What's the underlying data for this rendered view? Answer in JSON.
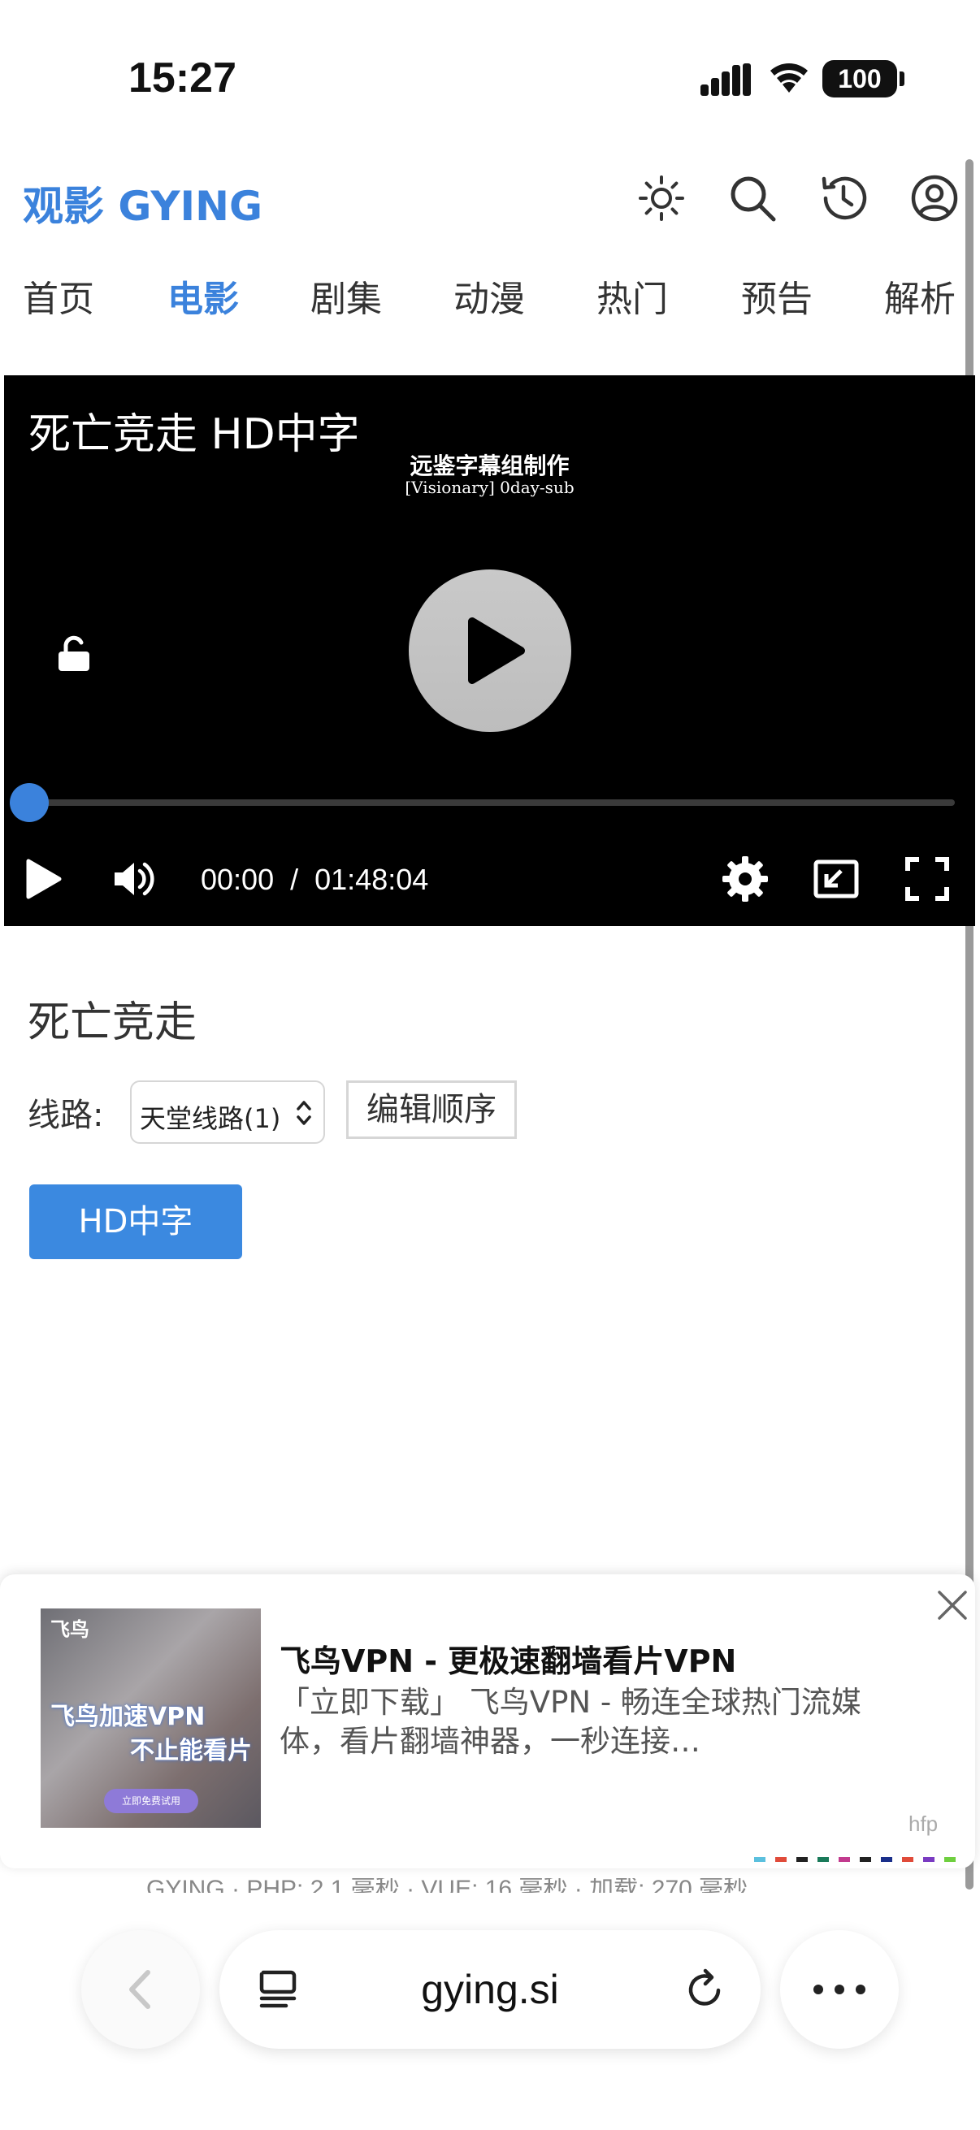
{
  "status_bar": {
    "time": "15:27",
    "battery": "100"
  },
  "header": {
    "site_title": "观影 GYING"
  },
  "nav": {
    "items": [
      {
        "label": "首页"
      },
      {
        "label": "电影"
      },
      {
        "label": "剧集"
      },
      {
        "label": "动漫"
      },
      {
        "label": "热门"
      },
      {
        "label": "预告"
      },
      {
        "label": "解析"
      }
    ],
    "active_index": 1
  },
  "player": {
    "title": "死亡竞走 HD中字",
    "subtitle_credit_line1": "远鉴字幕组制作",
    "subtitle_credit_line2": "[Visionary] 0day-sub",
    "current_time": "00:00",
    "separator": "/",
    "duration": "01:48:04",
    "progress_fraction": 0
  },
  "details": {
    "movie_title": "死亡竞走",
    "route_label": "线路:",
    "route_selected": "天堂线路(1)",
    "edit_order_label": "编辑顺序",
    "episodes": [
      {
        "label": "HD中字"
      }
    ]
  },
  "ad": {
    "image_brand": "飞鸟",
    "image_line1": "飞鸟加速VPN",
    "image_line2": "不止能看片",
    "image_button": "立即免费试用",
    "title": "飞鸟VPN - 更极速翻墙看片VPN",
    "description": "「立即下载」 飞鸟VPN - 畅连全球热门流媒体，看片翻墙神器，一秒连接…",
    "tag": "hfp",
    "strip_colors": [
      "#5bc0de",
      "#e04b3a",
      "#222222",
      "#1a7a5a",
      "#c23b8e",
      "#222222",
      "#1a2f8a",
      "#e04b3a",
      "#7a3bc2",
      "#6fcf3f"
    ]
  },
  "footer": {
    "peek_text": "GYING · PHP: 2.1 毫秒 · VUE: 16 毫秒 · 加载: 270 毫秒"
  },
  "browser": {
    "url": "gying.si"
  },
  "colors": {
    "accent": "#3b82dc",
    "button": "#3b89e0"
  }
}
